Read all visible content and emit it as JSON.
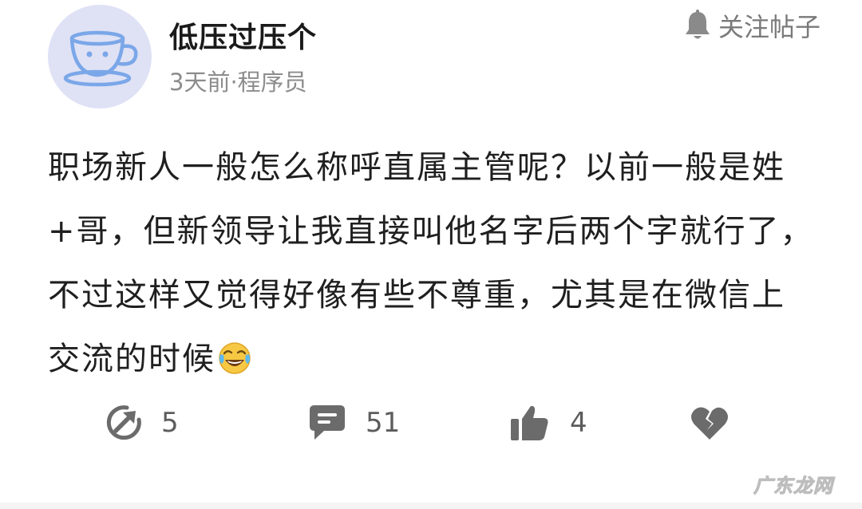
{
  "post": {
    "author": "低压过压个",
    "meta": "3天前·程序员",
    "follow_label": "关注帖子",
    "content": "职场新人一般怎么称呼直属主管呢？以前一般是姓+哥，但新领导让我直接叫他名字后两个字就行了，不过这样又觉得好像有些不尊重，尤其是在微信上交流的时候"
  },
  "actions": {
    "share": {
      "icon": "share-icon",
      "count": "5"
    },
    "comment": {
      "icon": "comment-icon",
      "count": "51"
    },
    "like": {
      "icon": "thumbs-up-icon",
      "count": "4"
    },
    "dislike": {
      "icon": "broken-heart-icon"
    }
  },
  "watermark": "广东龙网",
  "colors": {
    "avatar_bg": "#dfe1f5",
    "avatar_cup": "#7aa7e8",
    "icon_gray": "#6b6b6b",
    "meta_gray": "#8c8c8c"
  }
}
